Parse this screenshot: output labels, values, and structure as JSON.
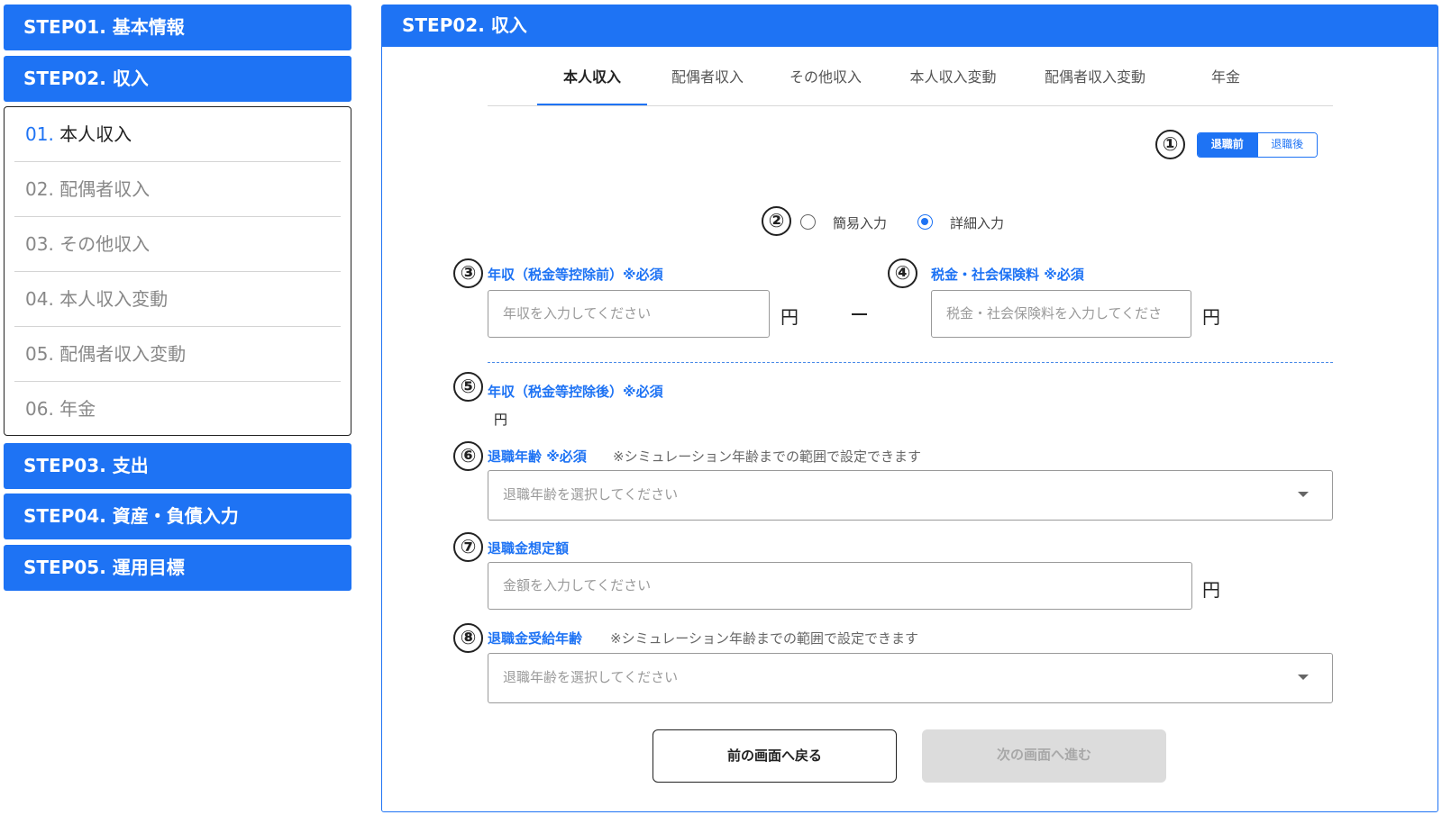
{
  "sidebar": {
    "steps_top": [
      {
        "label": "STEP01. 基本情報"
      },
      {
        "label": "STEP02. 収入"
      }
    ],
    "sub_items": [
      {
        "num": "01.",
        "label": "本人収入",
        "active": true
      },
      {
        "num": "02.",
        "label": "配偶者収入"
      },
      {
        "num": "03.",
        "label": "その他収入"
      },
      {
        "num": "04.",
        "label": "本人収入変動"
      },
      {
        "num": "05.",
        "label": "配偶者収入変動"
      },
      {
        "num": "06.",
        "label": "年金"
      }
    ],
    "steps_bottom": [
      {
        "label": "STEP03. 支出"
      },
      {
        "label": "STEP04. 資産・負債入力"
      },
      {
        "label": "STEP05. 運用目標"
      }
    ]
  },
  "panel": {
    "title": "STEP02. 収入",
    "tabs": [
      "本人収入",
      "配偶者収入",
      "その他収入",
      "本人収入変動",
      "配偶者収入変動",
      "年金"
    ],
    "active_tab": 0
  },
  "markers": [
    "①",
    "②",
    "③",
    "④",
    "⑤",
    "⑥",
    "⑦",
    "⑧"
  ],
  "toggle": {
    "on": "退職前",
    "off": "退職後"
  },
  "input_mode": {
    "simple": "簡易入力",
    "detail": "詳細入力",
    "selected": "detail"
  },
  "fields": {
    "annual_income": {
      "label": "年収（税金等控除前）※必須",
      "placeholder": "年収を入力してください",
      "unit": "円"
    },
    "tax": {
      "label": "税金・社会保険料 ※必須",
      "placeholder": "税金・社会保険料を入力してくださ",
      "unit": "円"
    },
    "net_income": {
      "label": "年収（税金等控除後）※必須",
      "unit": "円"
    },
    "retire_age": {
      "label": "退職年齢 ※必須",
      "note": "※シミュレーション年齢までの範囲で設定できます",
      "placeholder": "退職年齢を選択してください"
    },
    "retire_pay": {
      "label": "退職金想定額",
      "placeholder": "金額を入力してください",
      "unit": "円"
    },
    "retire_pay_age": {
      "label": "退職金受給年齢",
      "note": "※シミュレーション年齢までの範囲で設定できます",
      "placeholder": "退職年齢を選択してください"
    }
  },
  "buttons": {
    "back": "前の画面へ戻る",
    "next": "次の画面へ進む"
  },
  "colors": {
    "accent": "#1e73f4",
    "disabled": "#dcdcdc"
  }
}
